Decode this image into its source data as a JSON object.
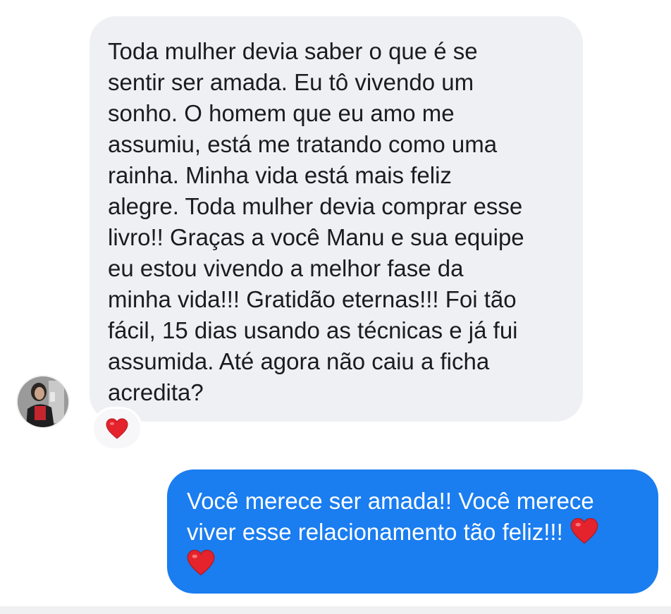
{
  "conversation": {
    "incoming_message": {
      "lines": [
        "Toda mulher devia saber o que é se",
        "sentir ser amada. Eu tô vivendo um",
        "sonho. O homem que eu amo me",
        "assumiu, está me tratando como uma",
        "rainha. Minha vida está mais feliz",
        "alegre. Toda mulher devia comprar esse",
        "livro!! Graças a você Manu e sua equipe",
        "eu estou vivendo a melhor fase da",
        "minha vida!!! Gratidão eternas!!! Foi tão",
        "fácil, 15 dias usando as técnicas e já fui",
        "assumida. Até agora não caiu a ficha",
        "acredita?"
      ],
      "reaction": "heart-icon"
    },
    "outgoing_message": {
      "lines": [
        "Você merece ser amada!! Você merece",
        "viver esse relacionamento tão feliz!!!"
      ],
      "emoji": "heart-icon"
    }
  },
  "colors": {
    "incoming_bubble": "#eff0f4",
    "outgoing_bubble": "#1a7df0",
    "heart": "#e5232c"
  }
}
